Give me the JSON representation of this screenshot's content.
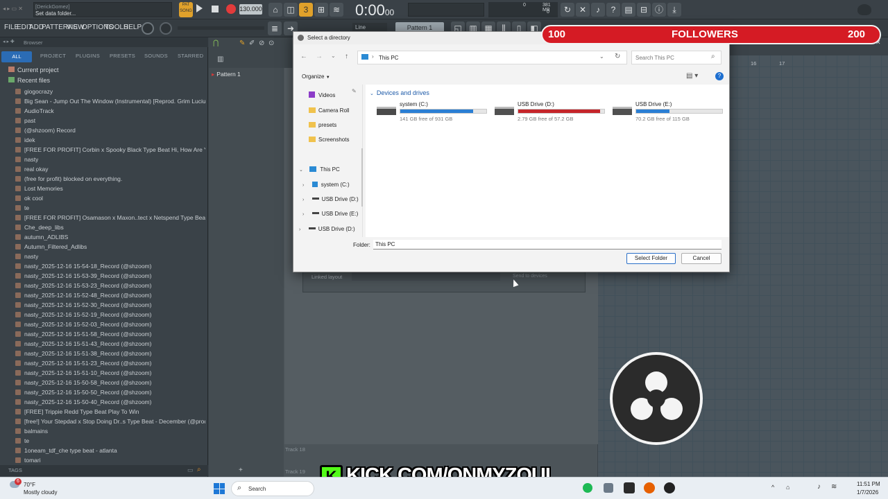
{
  "topbar": {
    "hint_name": "[DerickGomez]",
    "hint_text": "Set data folder...",
    "tempo": "130.000",
    "time": "0:00",
    "time_small": "00",
    "mem": "381 MB",
    "mem_zero": "0",
    "cpu_zero": "0",
    "pat_label": "PAT",
    "song_label": "SONG",
    "line_label": "Line",
    "pattern_select": "Pattern 1"
  },
  "menubar": {
    "items": [
      "FILE",
      "EDIT",
      "ADD",
      "PATTERNS",
      "VIEW",
      "OPTIONS",
      "TOOLS",
      "HELP"
    ]
  },
  "browser": {
    "title": "Browser",
    "tabs": [
      "ALL",
      "PROJECT",
      "PLUGINS",
      "PRESETS",
      "SOUNDS",
      "STARRED"
    ],
    "current_project": "Current project",
    "recent_files": "Recent files",
    "files": [
      "giogocrazy",
      "Big Sean - Jump Out The Window (Instrumental) [Reprod. Grim Lucius] Best",
      "AudioTrack",
      "past",
      "(@shzoom) Record",
      "idek",
      "[FREE FOR PROFIT] Corbin x Spooky Black Type Beat Hi, How Are You_ (1)",
      "nasty",
      "real okay",
      "(free for profit) blocked on everything.",
      "Lost Memories",
      "ok cool",
      "te",
      "[FREE FOR PROFIT] Osamason x Maxon..tect x Netspend Type Beat - Coughing",
      "Che_deep_libs",
      "autumn_ADLIBS",
      "Autumn_Filtered_Adlibs",
      "nasty",
      "nasty_2025-12-16 15-54-18_Record (@shzoom)",
      "nasty_2025-12-16 15-53-39_Record (@shzoom)",
      "nasty_2025-12-16 15-53-23_Record (@shzoom)",
      "nasty_2025-12-16 15-52-48_Record (@shzoom)",
      "nasty_2025-12-16 15-52-30_Record (@shzoom)",
      "nasty_2025-12-16 15-52-19_Record (@shzoom)",
      "nasty_2025-12-16 15-52-03_Record (@shzoom)",
      "nasty_2025-12-16 15-51-58_Record (@shzoom)",
      "nasty_2025-12-16 15-51-43_Record (@shzoom)",
      "nasty_2025-12-16 15-51-38_Record (@shzoom)",
      "nasty_2025-12-16 15-51-23_Record (@shzoom)",
      "nasty_2025-12-16 15-51-10_Record (@shzoom)",
      "nasty_2025-12-16 15-50-58_Record (@shzoom)",
      "nasty_2025-12-16 15-50-50_Record (@shzoom)",
      "nasty_2025-12-16 15-50-40_Record (@shzoom)",
      "[FREE] Trippie Redd Type Beat Play To Win",
      "[free!] Your Stepdad x Stop Doing Dr..s Type Beat - December (@prod.4head)",
      "balmains",
      "te",
      "1oneam_tdf_che type beat - atlanta",
      "tomari"
    ],
    "tags_label": "TAGS"
  },
  "channel": {
    "pattern_name": "Pattern 1",
    "linked_layout": "Linked layout",
    "send_to_devices": "Send to devices",
    "track18": "Track 18",
    "track19": "Track 19"
  },
  "playlist": {
    "ruler": [
      "16",
      "17"
    ]
  },
  "dialog": {
    "title": "Select a directory",
    "address": "This PC",
    "search_placeholder": "Search This PC",
    "organize": "Organize",
    "nav": [
      "Videos",
      "Camera Roll",
      "presets",
      "Screenshots"
    ],
    "tree_root": "This PC",
    "tree": [
      "system (C:)",
      "USB Drive (D:)",
      "USB Drive (E:)",
      "USB Drive (D:)"
    ],
    "section": "Devices and drives",
    "drives": [
      {
        "name": "system (C:)",
        "free": "141 GB free of 931 GB",
        "fill": 0.85,
        "color": "#2b7fd4"
      },
      {
        "name": "USB Drive (D:)",
        "free": "2.79 GB free of 57.2 GB",
        "fill": 0.95,
        "color": "#c5252a"
      },
      {
        "name": "USB Drive (E:)",
        "free": "70.2 GB free of 115 GB",
        "fill": 0.39,
        "color": "#2b7fd4"
      }
    ],
    "folder_label": "Folder:",
    "folder_value": "This PC",
    "select_button": "Select Folder",
    "cancel_button": "Cancel"
  },
  "overlay": {
    "followers_start": "100",
    "followers_label": "FOLLOWERS",
    "followers_goal": "200",
    "kick_text": "KICK.COM/ONMYZOUL",
    "kick_letter": "K"
  },
  "taskbar": {
    "weather_temp": "70°F",
    "weather_desc": "Mostly cloudy",
    "badge": "6",
    "search_label": "Search",
    "time": "11:51 PM",
    "date": "1/7/2026"
  }
}
